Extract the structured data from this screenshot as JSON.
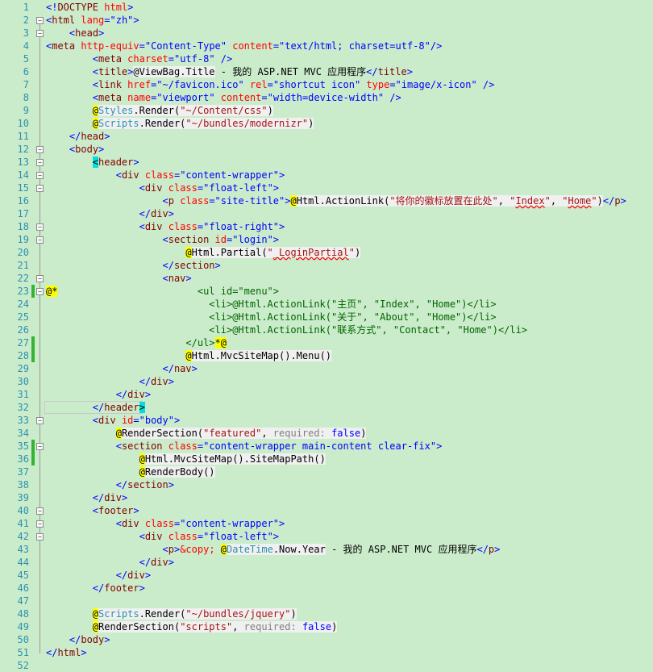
{
  "editor": {
    "lines": [
      {
        "n": "1",
        "html": "<span class='br'>&lt;!</span><span class='tag'>DOCTYPE</span> <span class='attr'>html</span><span class='br'>&gt;</span>"
      },
      {
        "n": "2",
        "html": "<span class='br'>&lt;</span><span class='tag'>html</span> <span class='attr'>lang</span><span class='br'>=\"zh\"&gt;</span>"
      },
      {
        "n": "3",
        "html": "    <span class='br'>&lt;</span><span class='tag'>head</span><span class='br'>&gt;</span>"
      },
      {
        "n": "4",
        "html": "<span class='br'>&lt;</span><span class='tag'>meta</span> <span class='attr'>http-equiv</span><span class='br'>=\"Content-Type\"</span> <span class='attr'>content</span><span class='br'>=\"text/html; charset=utf-8\"/&gt;</span>"
      },
      {
        "n": "5",
        "html": "        <span class='br'>&lt;</span><span class='tag'>meta</span> <span class='attr'>charset</span><span class='br'>=\"utf-8\" /&gt;</span>"
      },
      {
        "n": "6",
        "html": "        <span class='br'>&lt;</span><span class='tag'>title</span><span class='br'>&gt;</span><span class='razor'>@ViewBag.Title</span> - 我的 ASP.NET MVC 应用程序<span class='br'>&lt;/</span><span class='tag'>title</span><span class='br'>&gt;</span>"
      },
      {
        "n": "7",
        "html": "        <span class='br'>&lt;</span><span class='tag'>link</span> <span class='attr'>href</span><span class='br'>=\"~/favicon.ico\"</span> <span class='attr'>rel</span><span class='br'>=\"shortcut icon\"</span> <span class='attr'>type</span><span class='br'>=\"image/x-icon\" /&gt;</span>"
      },
      {
        "n": "8",
        "html": "        <span class='br'>&lt;</span><span class='tag'>meta</span> <span class='attr'>name</span><span class='br'>=\"viewport\"</span> <span class='attr'>content</span><span class='br'>=\"width=device-width\" /&gt;</span>"
      },
      {
        "n": "9",
        "html": "        <span class='at'>@</span><span class='razor'><span class='type'>Styles</span>.Render(<span class='str'>\"~/Content/css\"</span>)</span>"
      },
      {
        "n": "10",
        "html": "        <span class='at'>@</span><span class='razor'><span class='type'>Scripts</span>.Render(<span class='str'>\"~/bundles/modernizr\"</span>)</span>"
      },
      {
        "n": "11",
        "html": "    <span class='br'>&lt;/</span><span class='tag'>head</span><span class='br'>&gt;</span>"
      },
      {
        "n": "12",
        "html": "    <span class='br'>&lt;</span><span class='tag'>body</span><span class='br'>&gt;</span>"
      },
      {
        "n": "13",
        "html": "        <span class='sel'>&lt;</span><span class='tag'>header</span><span class='br'>&gt;</span>"
      },
      {
        "n": "14",
        "html": "            <span class='br'>&lt;</span><span class='tag'>div</span> <span class='attr'>class</span><span class='br'>=\"content-wrapper\"&gt;</span>"
      },
      {
        "n": "15",
        "html": "                <span class='br'>&lt;</span><span class='tag'>div</span> <span class='attr'>class</span><span class='br'>=\"float-left\"&gt;</span>"
      },
      {
        "n": "16",
        "html": "                    <span class='br'>&lt;</span><span class='tag'>p</span> <span class='attr'>class</span><span class='br'>=\"site-title\"&gt;</span><span class='at'>@</span><span class='razor'>Html.ActionLink(<span class='str'>\"将你的徽标放置在此处\"</span>, <span class='str'>\"<span class='squig'>Index</span>\"</span>, <span class='str'>\"<span class='squig'>Home</span>\"</span>)</span><span class='br'>&lt;/</span><span class='tag'>p</span><span class='br'>&gt;</span>"
      },
      {
        "n": "17",
        "html": "                <span class='br'>&lt;/</span><span class='tag'>div</span><span class='br'>&gt;</span>"
      },
      {
        "n": "18",
        "html": "                <span class='br'>&lt;</span><span class='tag'>div</span> <span class='attr'>class</span><span class='br'>=\"float-right\"&gt;</span>"
      },
      {
        "n": "19",
        "html": "                    <span class='br'>&lt;</span><span class='tag'>section</span> <span class='attr'>id</span><span class='br'>=\"login\"&gt;</span>"
      },
      {
        "n": "20",
        "html": "                        <span class='at'>@</span><span class='razor'>Html.Partial(<span class='str'>\"<span class='squig'>_LoginPartial</span>\"</span>)</span>"
      },
      {
        "n": "21",
        "html": "                    <span class='br'>&lt;/</span><span class='tag'>section</span><span class='br'>&gt;</span>"
      },
      {
        "n": "22",
        "html": "                    <span class='br'>&lt;</span><span class='tag'>nav</span><span class='br'>&gt;</span>"
      },
      {
        "n": "23",
        "html": "<span class='at'>@*</span><span class='cmt'>                        &lt;ul id=\"menu\"&gt;</span>"
      },
      {
        "n": "24",
        "html": "<span class='cmt'>                            &lt;li&gt;@Html.ActionLink(\"主页\", \"Index\", \"Home\")&lt;/li&gt;</span>"
      },
      {
        "n": "25",
        "html": "<span class='cmt'>                            &lt;li&gt;@Html.ActionLink(\"关于\", \"About\", \"Home\")&lt;/li&gt;</span>"
      },
      {
        "n": "26",
        "html": "<span class='cmt'>                            &lt;li&gt;@Html.ActionLink(\"联系方式\", \"Contact\", \"Home\")&lt;/li&gt;</span>"
      },
      {
        "n": "27",
        "html": "<span class='cmt'>                        &lt;/ul&gt;</span><span class='at'>*@</span>"
      },
      {
        "n": "28",
        "html": "                        <span class='at'>@</span><span class='razor'>Html.MvcSiteMap().Menu()</span>"
      },
      {
        "n": "29",
        "html": "                    <span class='br'>&lt;/</span><span class='tag'>nav</span><span class='br'>&gt;</span>"
      },
      {
        "n": "30",
        "html": "                <span class='br'>&lt;/</span><span class='tag'>div</span><span class='br'>&gt;</span>"
      },
      {
        "n": "31",
        "html": "            <span class='br'>&lt;/</span><span class='tag'>div</span><span class='br'>&gt;</span>"
      },
      {
        "n": "32",
        "html": "        <span class='br'>&lt;/</span><span class='tag'>header</span><span class='sel'>&gt;</span>"
      },
      {
        "n": "33",
        "html": "        <span class='br'>&lt;</span><span class='tag'>div</span> <span class='attr'>id</span><span class='br'>=\"body\"&gt;</span>"
      },
      {
        "n": "34",
        "html": "            <span class='at'>@</span><span class='razor'>RenderSection(<span class='str'>\"featured\"</span>, <span class='hint'>required:</span> <span class='kw'>false</span>)</span>"
      },
      {
        "n": "35",
        "html": "            <span class='br'>&lt;</span><span class='tag'>section</span> <span class='attr'>class</span><span class='br'>=\"content-wrapper main-content clear-fix\"&gt;</span>"
      },
      {
        "n": "36",
        "html": "                <span class='at'>@</span><span class='razor'>Html.MvcSiteMap().SiteMapPath()</span>"
      },
      {
        "n": "37",
        "html": "                <span class='at'>@</span><span class='razor'>RenderBody()</span>"
      },
      {
        "n": "38",
        "html": "            <span class='br'>&lt;/</span><span class='tag'>section</span><span class='br'>&gt;</span>"
      },
      {
        "n": "39",
        "html": "        <span class='br'>&lt;/</span><span class='tag'>div</span><span class='br'>&gt;</span>"
      },
      {
        "n": "40",
        "html": "        <span class='br'>&lt;</span><span class='tag'>footer</span><span class='br'>&gt;</span>"
      },
      {
        "n": "41",
        "html": "            <span class='br'>&lt;</span><span class='tag'>div</span> <span class='attr'>class</span><span class='br'>=\"content-wrapper\"&gt;</span>"
      },
      {
        "n": "42",
        "html": "                <span class='br'>&lt;</span><span class='tag'>div</span> <span class='attr'>class</span><span class='br'>=\"float-left\"&gt;</span>"
      },
      {
        "n": "43",
        "html": "                    <span class='br'>&lt;</span><span class='tag'>p</span><span class='br'>&gt;</span><span class='attr'>&amp;copy;</span> <span class='at'>@</span><span class='razor'><span class='type'>DateTime</span>.Now.Year</span> - 我的 ASP.NET MVC 应用程序<span class='br'>&lt;/</span><span class='tag'>p</span><span class='br'>&gt;</span>"
      },
      {
        "n": "44",
        "html": "                <span class='br'>&lt;/</span><span class='tag'>div</span><span class='br'>&gt;</span>"
      },
      {
        "n": "45",
        "html": "            <span class='br'>&lt;/</span><span class='tag'>div</span><span class='br'>&gt;</span>"
      },
      {
        "n": "46",
        "html": "        <span class='br'>&lt;/</span><span class='tag'>footer</span><span class='br'>&gt;</span>"
      },
      {
        "n": "47",
        "html": ""
      },
      {
        "n": "48",
        "html": "        <span class='at'>@</span><span class='razor'><span class='type'>Scripts</span>.Render(<span class='str'>\"~/bundles/jquery\"</span>)</span>"
      },
      {
        "n": "49",
        "html": "        <span class='at'>@</span><span class='razor'>RenderSection(<span class='str'>\"scripts\"</span>, <span class='hint'>required:</span> <span class='kw'>false</span>)</span>"
      },
      {
        "n": "50",
        "html": "    <span class='br'>&lt;/</span><span class='tag'>body</span><span class='br'>&gt;</span>"
      },
      {
        "n": "51",
        "html": "<span class='br'>&lt;/</span><span class='tag'>html</span><span class='br'>&gt;</span>"
      },
      {
        "n": "52",
        "html": ""
      }
    ],
    "changed_lines": [
      "23",
      "27",
      "28",
      "35",
      "36"
    ],
    "fold_lines": [
      "2",
      "3",
      "12",
      "13",
      "14",
      "15",
      "18",
      "19",
      "22",
      "23",
      "33",
      "35",
      "40",
      "41",
      "42"
    ],
    "current_line": "32",
    "colors": {
      "background": "#cbeccb",
      "line_number": "#2b91af",
      "change_marker": "#35b335",
      "razor_marker": "#ffff00",
      "brace_match": "#00e0e0"
    }
  }
}
